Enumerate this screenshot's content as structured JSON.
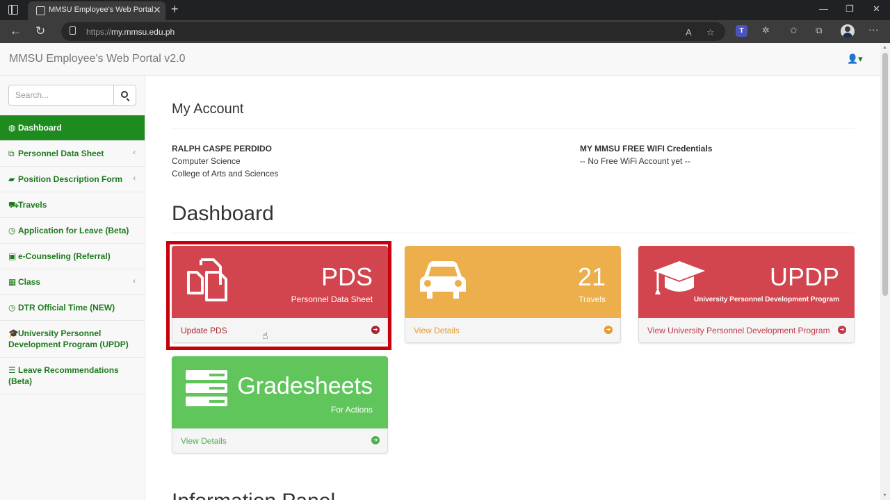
{
  "browser": {
    "tab_title": "MMSU Employee's Web Portal",
    "url_prefix": "https://",
    "url_host": "my.mmsu.edu.ph",
    "tab_close": "✕",
    "new_tab": "+",
    "minimize": "—",
    "restore": "❐",
    "close": "✕",
    "read_aloud": "A",
    "teams": "T"
  },
  "header": {
    "brand": "MMSU Employee's Web Portal v2.0",
    "user_menu_icon": "user-icon"
  },
  "sidebar": {
    "search_placeholder": "Search...",
    "items": [
      {
        "label": "Dashboard",
        "icon": "dashboard-icon",
        "glyph": "◍",
        "active": true,
        "caret": ""
      },
      {
        "label": "Personnel Data Sheet",
        "icon": "files-icon",
        "glyph": "⧉",
        "active": false,
        "caret": "‹"
      },
      {
        "label": "Position Description Form",
        "icon": "book-icon",
        "glyph": "▰",
        "active": false,
        "caret": "‹"
      },
      {
        "label": "Travels",
        "icon": "car-icon",
        "glyph": "⛟",
        "active": false,
        "caret": ""
      },
      {
        "label": "Application for Leave (Beta)",
        "icon": "clock-icon",
        "glyph": "◷",
        "active": false,
        "caret": ""
      },
      {
        "label": "e-Counseling (Referral)",
        "icon": "lock-icon",
        "glyph": "▣",
        "active": false,
        "caret": ""
      },
      {
        "label": "Class",
        "icon": "table-icon",
        "glyph": "▦",
        "active": false,
        "caret": "‹"
      },
      {
        "label": "DTR Official Time (NEW)",
        "icon": "clock-icon",
        "glyph": "◷",
        "active": false,
        "caret": ""
      },
      {
        "label": "University Personnel Development Program (UPDP)",
        "icon": "graduation-cap-icon",
        "glyph": "🎓",
        "active": false,
        "caret": ""
      },
      {
        "label": "Leave Recommendations (Beta)",
        "icon": "list-icon",
        "glyph": "☰",
        "active": false,
        "caret": ""
      }
    ]
  },
  "account": {
    "heading": "My Account",
    "name": "RALPH CASPE PERDIDO",
    "department": "Computer Science",
    "college": "College of Arts and Sciences",
    "wifi_title": "MY MMSU FREE WIFI Credentials",
    "wifi_status": "-- No Free WiFi Account yet --"
  },
  "dashboard": {
    "heading": "Dashboard",
    "panels": [
      {
        "id": "pds",
        "title": "PDS",
        "subtitle": "Personnel Data Sheet",
        "link": "Update PDS",
        "color": "#d2454f",
        "icon": "files-icon"
      },
      {
        "id": "travels",
        "title": "21",
        "subtitle": "Travels",
        "link": "View Details",
        "color": "#edae4c",
        "icon": "car-icon"
      },
      {
        "id": "updp",
        "title": "UPDP",
        "subtitle": "University Personnel Development Program",
        "link": "View University Personnel Development Program",
        "color": "#d2454f",
        "icon": "graduation-cap-icon"
      },
      {
        "id": "gradesheets",
        "title": "Gradesheets",
        "subtitle": "For Actions",
        "link": "View Details",
        "color": "#60c65b",
        "icon": "server-icon"
      }
    ]
  },
  "info_panel": {
    "heading": "Information Panel"
  },
  "colors": {
    "brand_green": "#1e8b1e",
    "highlight_red": "#c7000b"
  }
}
